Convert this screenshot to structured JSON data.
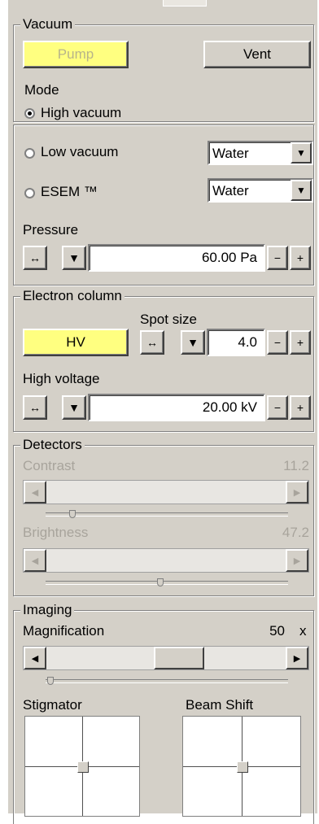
{
  "vacuum": {
    "title": "Vacuum",
    "pump_label": "Pump",
    "vent_label": "Vent",
    "mode_title": "Mode",
    "high_vacuum_label": "High vacuum",
    "low_vacuum_label": "Low vacuum",
    "low_vacuum_gas": "Water",
    "esem_label": "ESEM ™",
    "esem_gas": "Water",
    "pressure_label": "Pressure",
    "pressure_value": "60.00 Pa",
    "selected_mode": "High vacuum"
  },
  "electron_column": {
    "title": "Electron column",
    "hv_label": "HV",
    "spot_size_label": "Spot size",
    "spot_size_value": "4.0",
    "high_voltage_label": "High voltage",
    "high_voltage_value": "20.00 kV"
  },
  "detectors": {
    "title": "Detectors",
    "contrast_label": "Contrast",
    "contrast_value": "11.2",
    "contrast_level": 0.112,
    "brightness_label": "Brightness",
    "brightness_value": "47.2",
    "brightness_level": 0.472
  },
  "imaging": {
    "title": "Imaging",
    "magnification_label": "Magnification",
    "magnification_value": "50",
    "magnification_unit": "x",
    "stigmator_label": "Stigmator",
    "beam_shift_label": "Beam Shift"
  },
  "stepper": {
    "coarse_symbol": "↔",
    "down_symbol": "▼",
    "minus_symbol": "−",
    "plus_symbol": "+"
  },
  "colors": {
    "panel": "#d4d0c8",
    "highlight_yellow": "#ffff80"
  }
}
